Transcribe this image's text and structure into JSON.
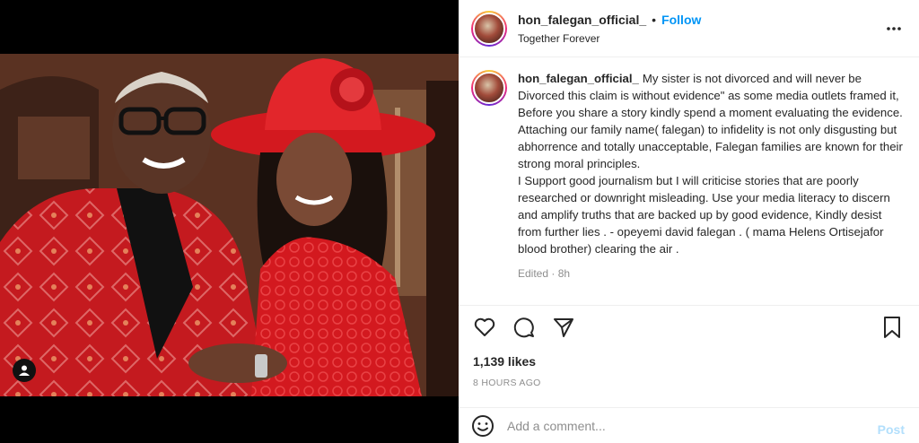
{
  "post": {
    "username": "hon_falegan_official_",
    "follow_label": "Follow",
    "separator": "•",
    "location": "Together Forever",
    "caption": "My sister is not divorced and will never be Divorced this claim is without evidence\" as some media outlets framed it, Before you share a story kindly spend a moment evaluating the evidence. Attaching our family name( falegan) to infidelity is not only disgusting but abhorrence and totally unacceptable, Falegan families are known for their strong moral principles.\nI Support good journalism but I will criticise stories that are poorly researched or downright misleading. Use your media literacy to discern and amplify truths that are backed up by good evidence, Kindly desist from further lies . - opeyemi david falegan . ( mama Helens Ortisejafor blood brother) clearing the air .",
    "caption_meta": "Edited · 8h",
    "likes": "1,139 likes",
    "time": "8 HOURS AGO"
  },
  "comment": {
    "placeholder": "Add a comment...",
    "post_label": "Post"
  },
  "colors": {
    "accent": "#0095f6",
    "post_disabled": "#b2dffc",
    "dress_red": "#d3191f"
  },
  "icons": [
    "heart-icon",
    "comment-icon",
    "share-icon",
    "bookmark-icon",
    "emoji-icon",
    "more-icon",
    "user-tag-icon"
  ]
}
